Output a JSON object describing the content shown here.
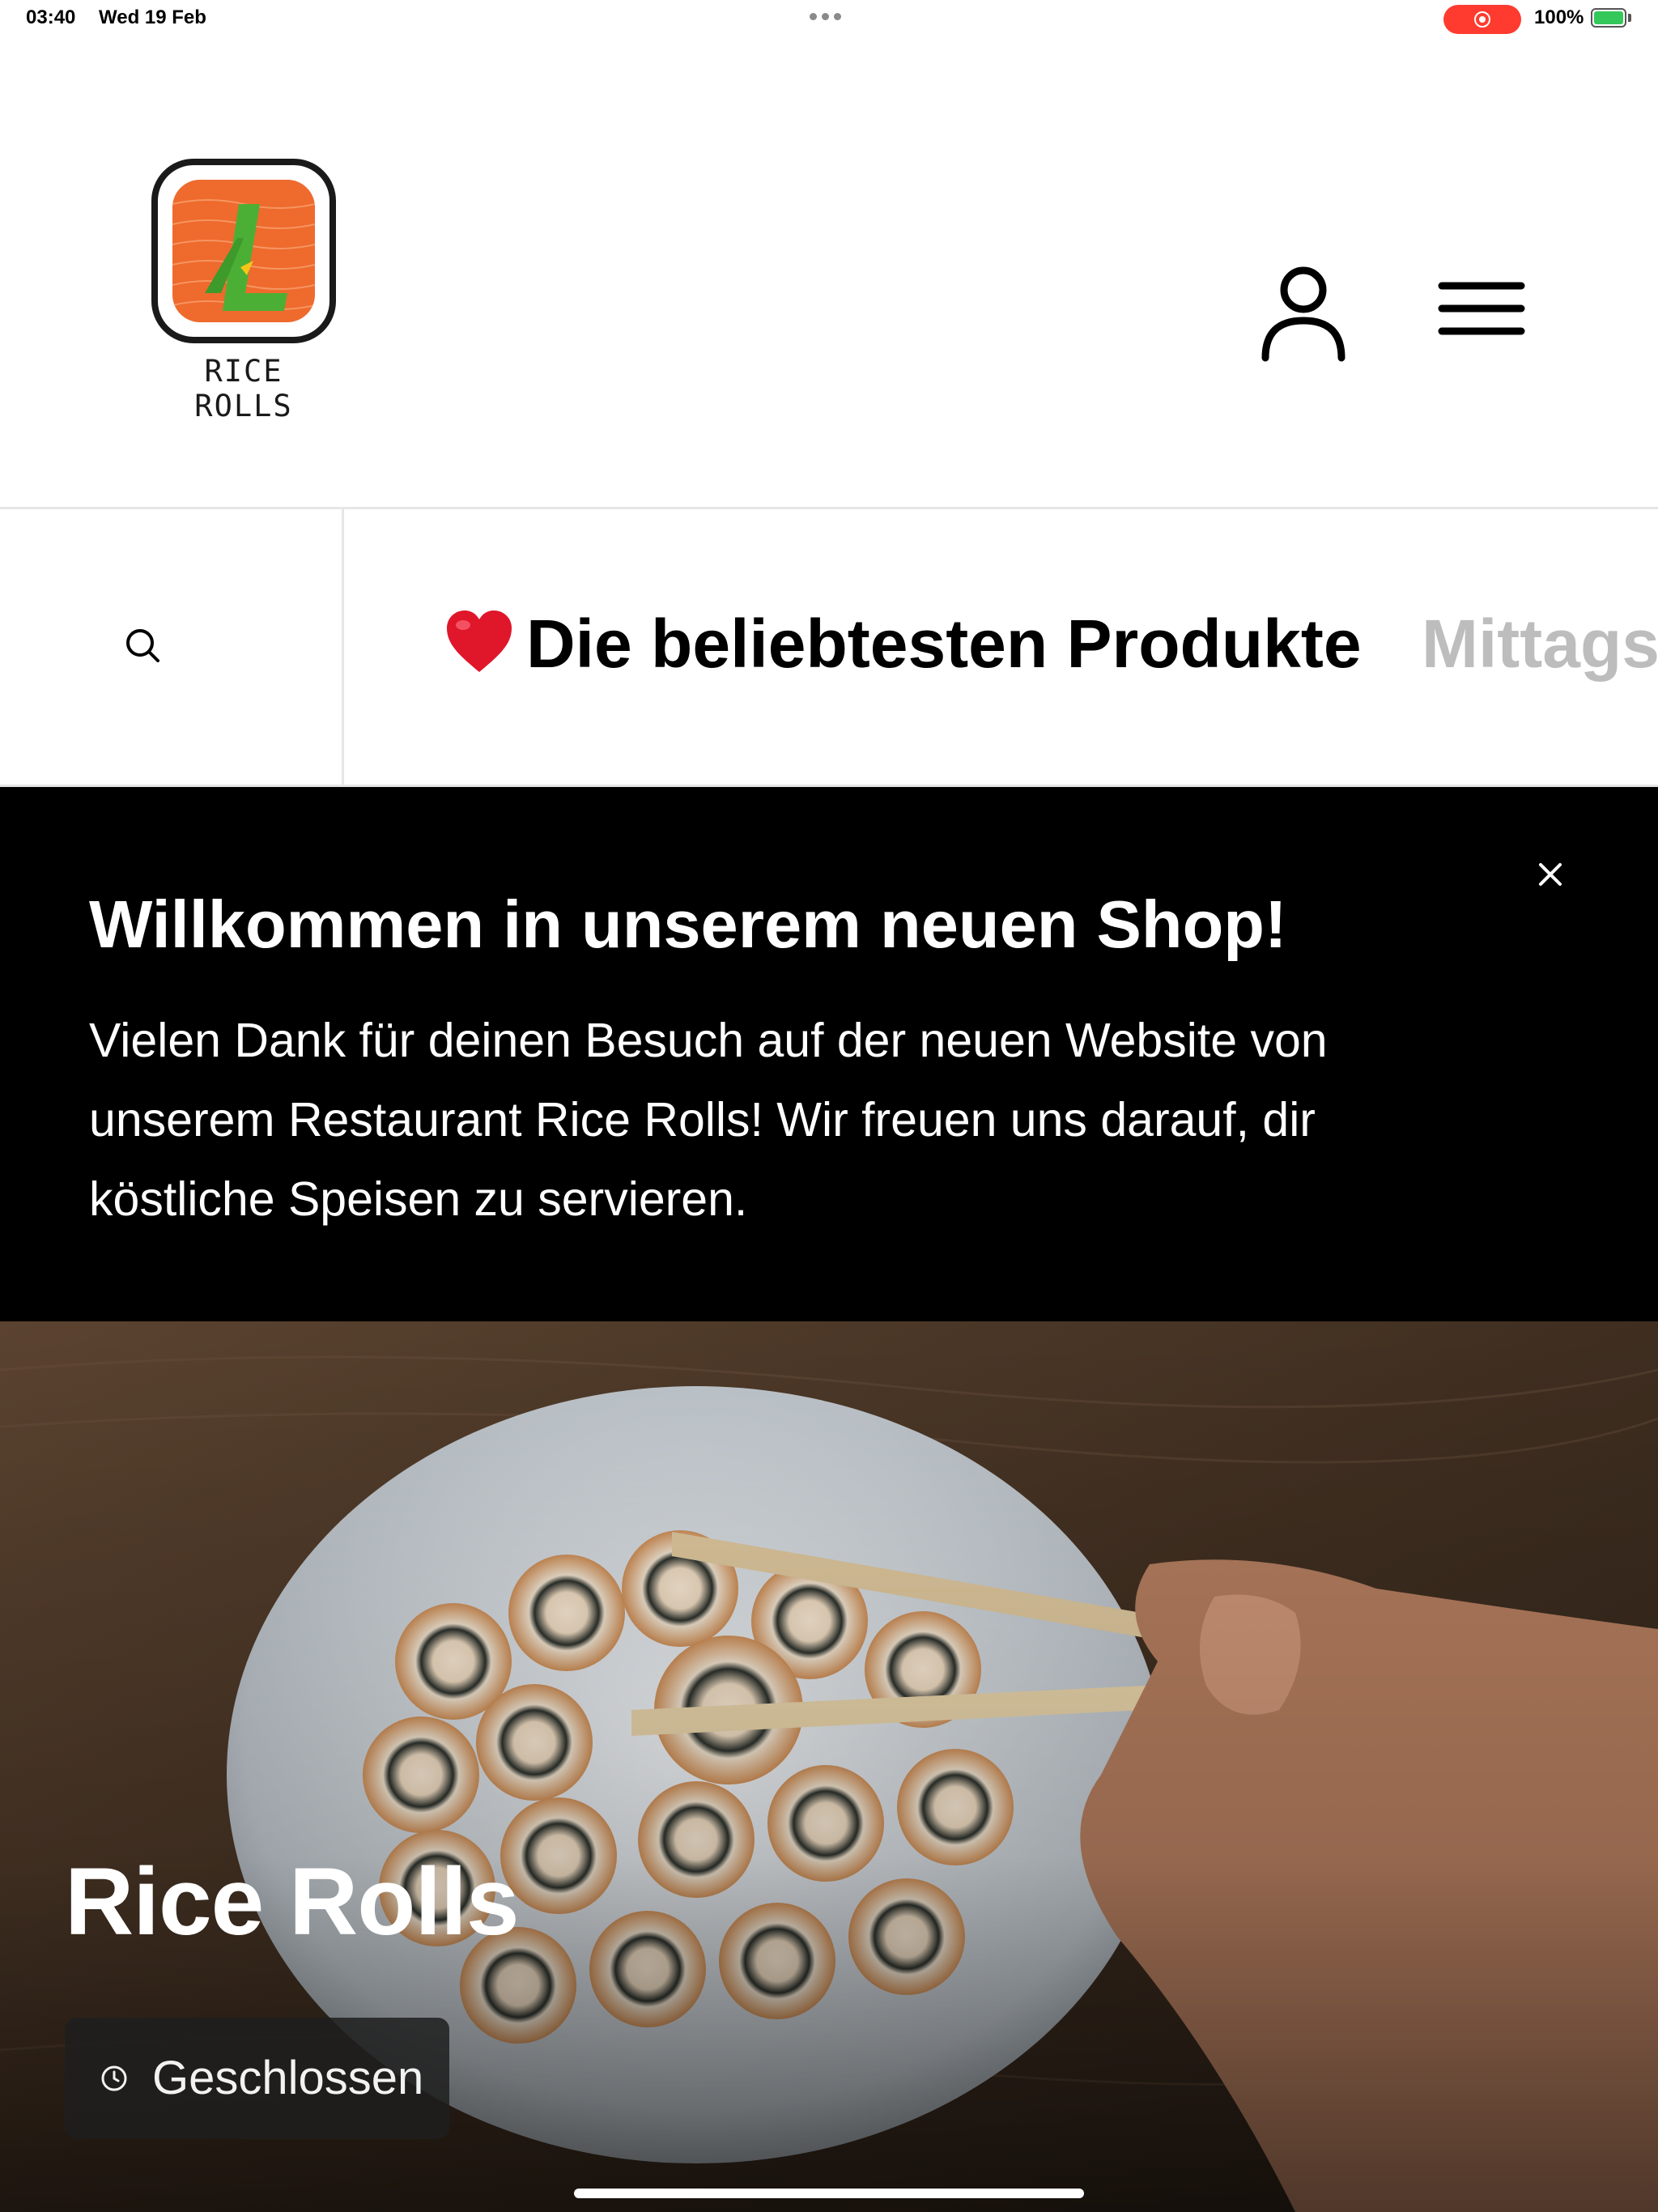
{
  "status_bar": {
    "time": "03:40",
    "date": "Wed 19 Feb",
    "battery": "100%",
    "battery_level": 1.0,
    "recording_color": "#ff3b30",
    "battery_color": "#34c759"
  },
  "header": {
    "logo_text": "RICE ROLLS",
    "logo_colors": {
      "frame": "#1a1a1a",
      "tile": "#ef6a2d",
      "mark": "#4caf35",
      "accent": "#f5c518"
    },
    "account_icon": "user-icon",
    "menu_icon": "hamburger-menu-icon"
  },
  "category_bar": {
    "search_icon": "search-icon",
    "active_category": "Die beliebtesten Produkte",
    "active_category_icon": "heart-icon",
    "next_category": "Mittags",
    "inactive_color": "#bdbdbd"
  },
  "welcome_banner": {
    "title": "Willkommen in unserem neuen Shop!",
    "text": "Vielen Dank für deinen Besuch auf der neuen Website von unserem Restaurant Rice Rolls! Wir freuen uns darauf, dir köstliche Speisen zu servieren.",
    "close_icon": "close-icon"
  },
  "hero": {
    "title": "Rice Rolls",
    "status": "Geschlossen",
    "status_icon": "clock-icon"
  }
}
